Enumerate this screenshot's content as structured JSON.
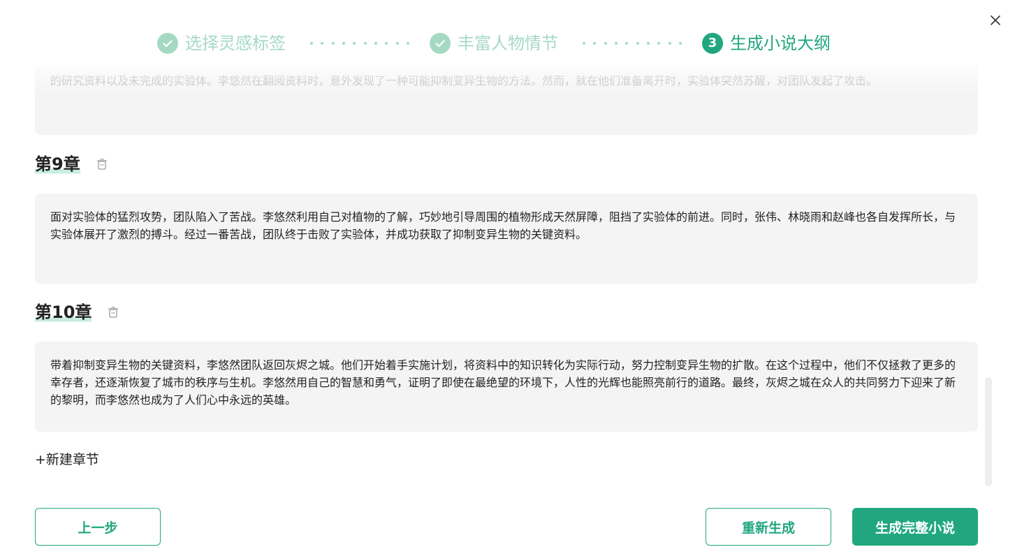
{
  "stepper": {
    "steps": [
      {
        "label": "选择灵感标签",
        "state": "done"
      },
      {
        "label": "丰富人物情节",
        "state": "done"
      },
      {
        "label": "生成小说大纲",
        "state": "active",
        "number": "3"
      }
    ]
  },
  "chapters": {
    "partial_text": "的研究资料以及未完成的实验体。李悠然在翻阅资料时，意外发现了一种可能抑制变异生物的方法。然而，就在他们准备离开时，实验体突然苏醒，对团队发起了攻击。",
    "items": [
      {
        "title": "第9章",
        "text": "面对实验体的猛烈攻势，团队陷入了苦战。李悠然利用自己对植物的了解，巧妙地引导周围的植物形成天然屏障，阻挡了实验体的前进。同时，张伟、林晓雨和赵峰也各自发挥所长，与实验体展开了激烈的搏斗。经过一番苦战，团队终于击败了实验体，并成功获取了抑制变异生物的关键资料。"
      },
      {
        "title": "第10章",
        "text": "带着抑制变异生物的关键资料，李悠然团队返回灰烬之城。他们开始着手实施计划，将资料中的知识转化为实际行动，努力控制变异生物的扩散。在这个过程中，他们不仅拯救了更多的幸存者，还逐渐恢复了城市的秩序与生机。李悠然用自己的智慧和勇气，证明了即使在最绝望的环境下，人性的光辉也能照亮前行的道路。最终，灰烬之城在众人的共同努力下迎来了新的黎明，而李悠然也成为了人们心中永远的英雄。"
      }
    ],
    "new_chapter_label": "+新建章节"
  },
  "footer": {
    "prev_label": "上一步",
    "regenerate_label": "重新生成",
    "generate_label": "生成完整小说"
  },
  "colors": {
    "accent": "#21a77f",
    "accent_light": "#a6d9c4",
    "card_bg": "#f4f4f4"
  },
  "icons": {
    "close": "close-icon",
    "check": "check-icon",
    "delete": "trash-icon"
  }
}
